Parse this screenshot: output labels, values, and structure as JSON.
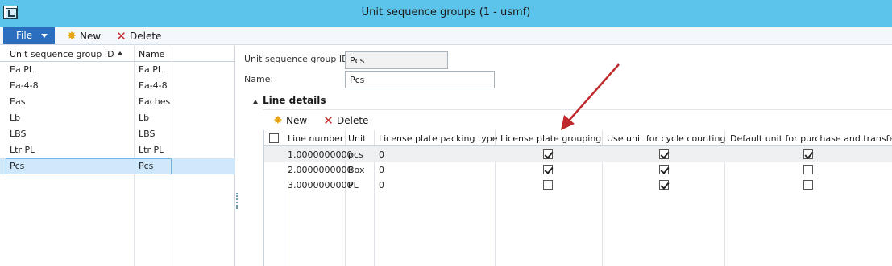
{
  "window": {
    "title": "Unit sequence groups (1 - usmf)"
  },
  "toolbar": {
    "file_label": "File",
    "new_label": "New",
    "delete_label": "Delete"
  },
  "left_grid": {
    "headers": {
      "id": "Unit sequence group ID",
      "name": "Name"
    },
    "rows": [
      {
        "id": "Ea PL",
        "name": "Ea PL"
      },
      {
        "id": "Ea-4-8",
        "name": "Ea-4-8"
      },
      {
        "id": "Eas",
        "name": "Eaches"
      },
      {
        "id": "Lb",
        "name": "Lb"
      },
      {
        "id": "LBS",
        "name": "LBS"
      },
      {
        "id": "Ltr PL",
        "name": "Ltr PL"
      },
      {
        "id": "Pcs",
        "name": "Pcs"
      }
    ],
    "selected_index": 6
  },
  "form": {
    "id_label": "Unit sequence group ID:",
    "id_value": "Pcs",
    "name_label": "Name:",
    "name_value": "Pcs"
  },
  "line_details": {
    "title": "Line details",
    "new_label": "New",
    "delete_label": "Delete",
    "headers": {
      "line_number": "Line number",
      "unit": "Unit",
      "packing_type": "License plate packing type",
      "plate_grouping": "License plate grouping",
      "cycle_counting": "Use unit for cycle counting",
      "default_unit": "Default unit for purchase and transfer"
    },
    "rows": [
      {
        "line_number": "1.0000000000",
        "unit": "pcs",
        "packing_type": "0",
        "plate_grouping": true,
        "cycle_counting": true,
        "default_unit": true
      },
      {
        "line_number": "2.0000000000",
        "unit": "Box",
        "packing_type": "0",
        "plate_grouping": true,
        "cycle_counting": true,
        "default_unit": false
      },
      {
        "line_number": "3.0000000000",
        "unit": "PL",
        "packing_type": "0",
        "plate_grouping": false,
        "cycle_counting": true,
        "default_unit": false
      }
    ]
  },
  "colors": {
    "titlebar": "#5cc3ea",
    "file_button": "#2a6fbf",
    "selection": "#cfe8fb",
    "annotation_arrow": "#c0292b"
  }
}
